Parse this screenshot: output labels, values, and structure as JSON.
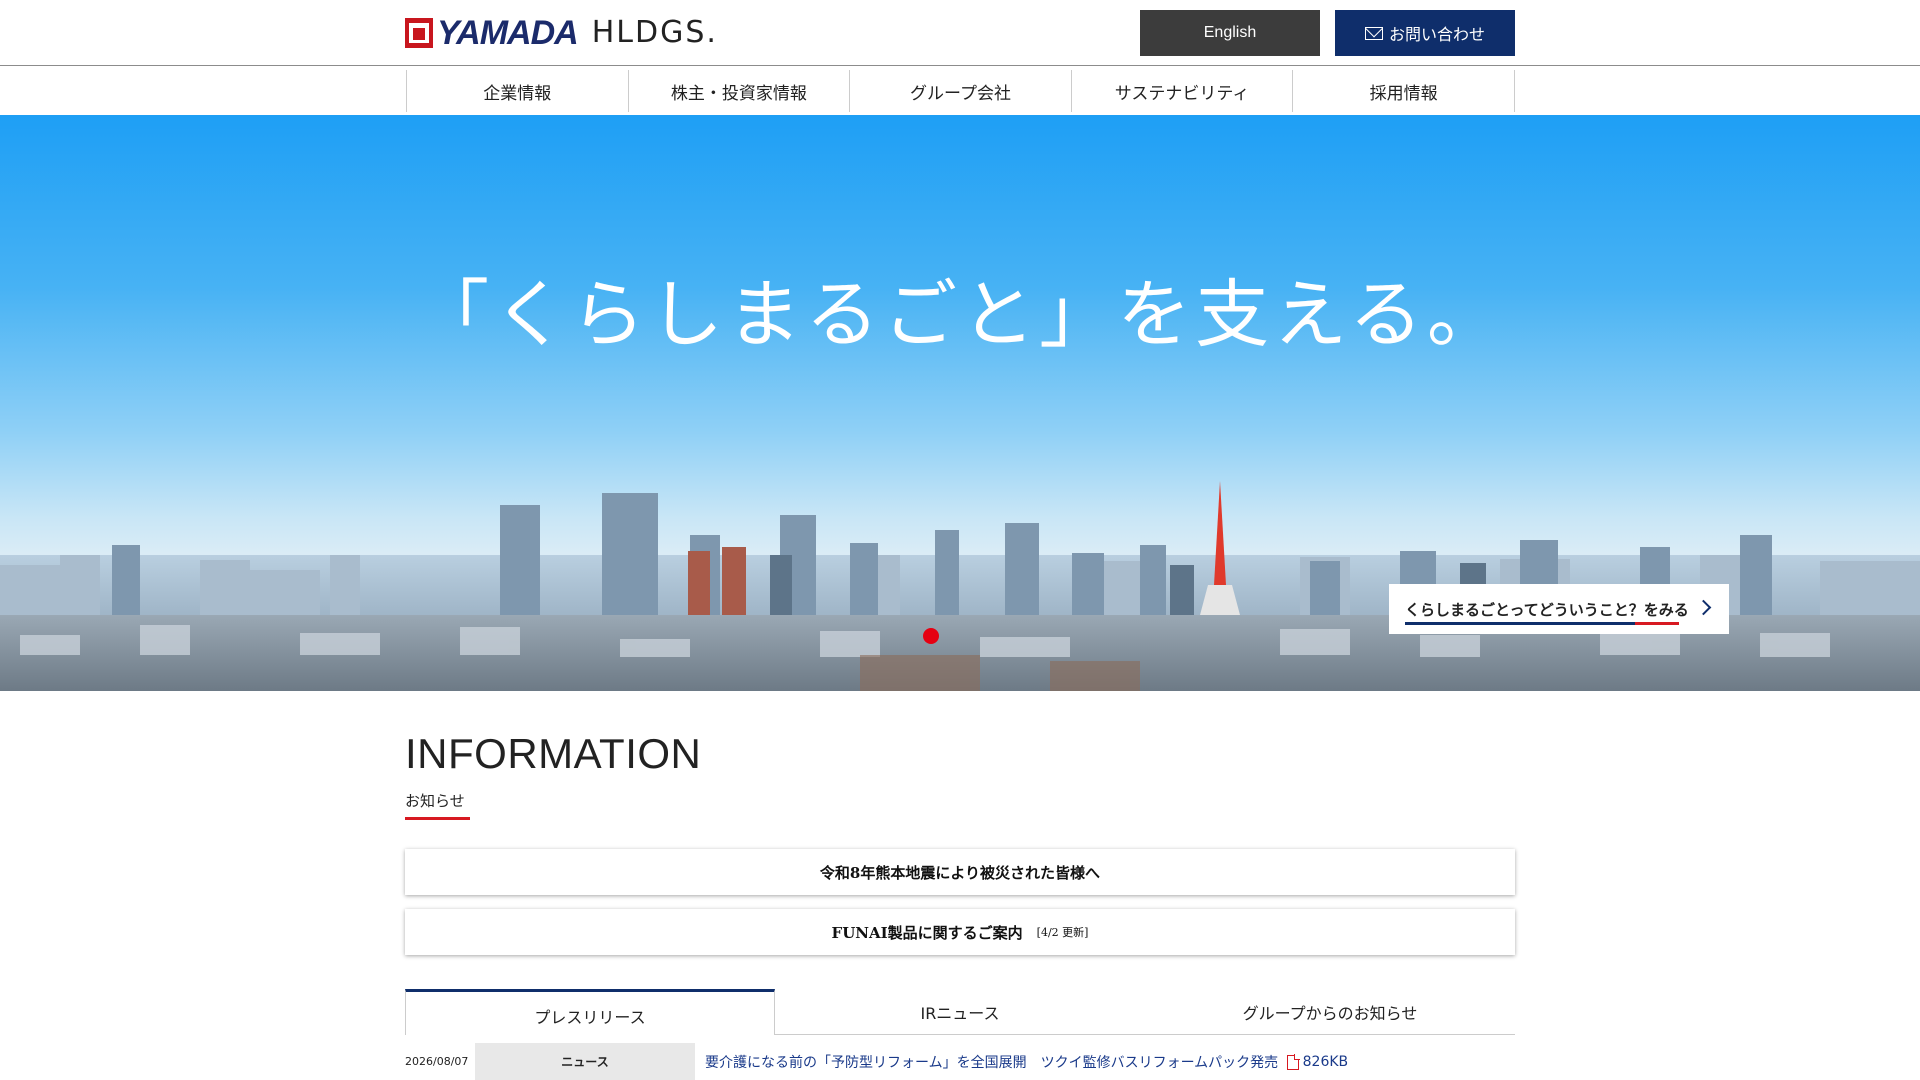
{
  "header": {
    "logo_brand": "YAMADA",
    "logo_suffix": "HLDGS.",
    "english_label": "English",
    "contact_label": "お問い合わせ"
  },
  "nav": {
    "items": [
      {
        "label": "企業情報"
      },
      {
        "label": "株主・投資家情報"
      },
      {
        "label": "グループ会社"
      },
      {
        "label": "サステナビリティ"
      },
      {
        "label": "採用情報"
      }
    ]
  },
  "hero": {
    "tagline": "「くらしまるごと」を支える。",
    "link_label": "くらしまるごとってどういうこと？をみる"
  },
  "information": {
    "title": "INFORMATION",
    "subtitle": "お知らせ",
    "notices": [
      {
        "text": "令和8年熊本地震により被災された皆様へ",
        "note": ""
      },
      {
        "text": "FUNAI製品に関するご案内",
        "note": "[4/2 更新]"
      }
    ],
    "tabs": [
      {
        "label": "プレスリリース",
        "active": true
      },
      {
        "label": "IRニュース",
        "active": false
      },
      {
        "label": "グループからのお知らせ",
        "active": false
      }
    ],
    "news": [
      {
        "date": "2026/08/07",
        "category": "ニュース",
        "title": "要介護になる前の「予防型リフォーム」を全国展開　ツクイ監修バスリフォームパック発売",
        "filesize": "826KB"
      }
    ]
  },
  "colors": {
    "brand_navy": "#0f2e6b",
    "brand_red": "#d71921",
    "english_button": "#3c3c3c"
  }
}
